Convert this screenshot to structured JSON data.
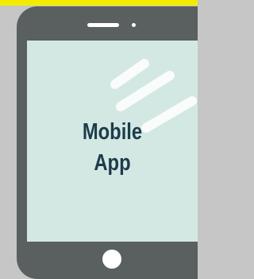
{
  "screen": {
    "label_line1": "Mobile",
    "label_line2": "App"
  },
  "colors": {
    "background": "#c6c6c6",
    "top_band": "#f4ec00",
    "device_body": "#59605f",
    "screen": "#d3e8e3",
    "label_text": "#1d3b4a",
    "glare": "#ffffff"
  },
  "icons": {
    "device": "tablet-icon",
    "speaker": "speaker-slot-icon",
    "camera": "camera-dot-icon",
    "home": "home-button-icon"
  }
}
